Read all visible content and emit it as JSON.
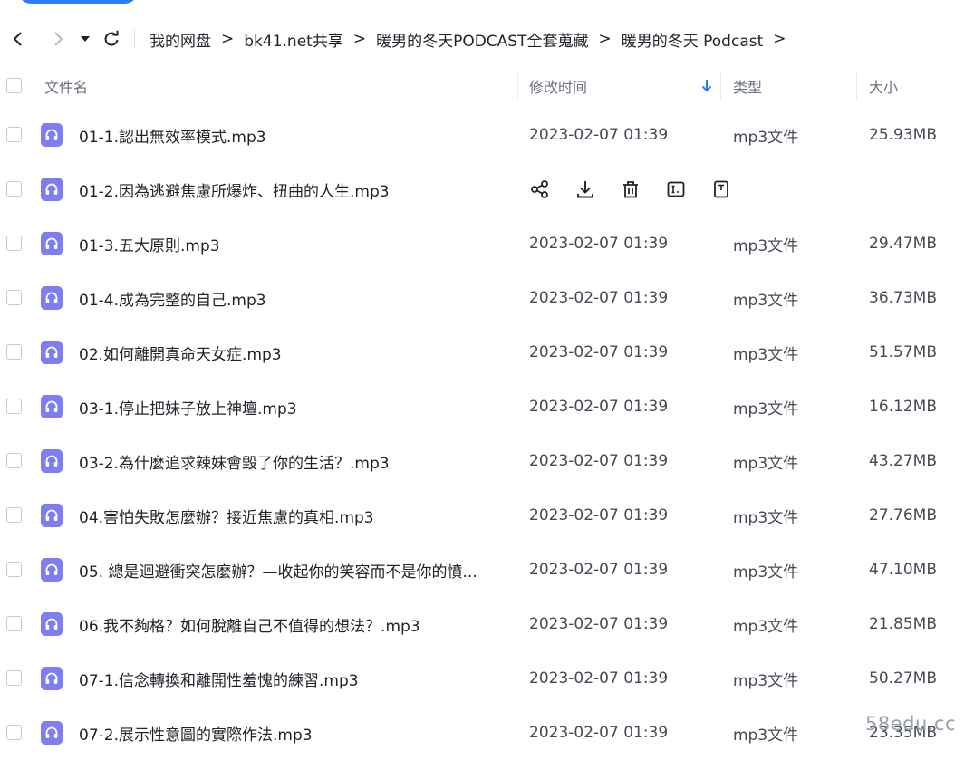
{
  "breadcrumb": [
    "我的网盘",
    "bk41.net共享",
    "暖男的冬天PODCAST全套蒐藏",
    "暖男的冬天 Podcast"
  ],
  "breadcrumb_separator": ">",
  "columns": {
    "name": "文件名",
    "modified": "修改时间",
    "type": "类型",
    "size": "大小"
  },
  "files": [
    {
      "name": "01-1.認出無效率模式.mp3",
      "modified": "2023-02-07 01:39",
      "type": "mp3文件",
      "size": "25.93MB"
    },
    {
      "name": "01-2.因為逃避焦慮所爆炸、扭曲的人生.mp3",
      "modified": "",
      "type": "",
      "size": "",
      "hovered": true
    },
    {
      "name": "01-3.五大原則.mp3",
      "modified": "2023-02-07 01:39",
      "type": "mp3文件",
      "size": "29.47MB"
    },
    {
      "name": "01-4.成為完整的自己.mp3",
      "modified": "2023-02-07 01:39",
      "type": "mp3文件",
      "size": "36.73MB"
    },
    {
      "name": "02.如何離開真命天女症.mp3",
      "modified": "2023-02-07 01:39",
      "type": "mp3文件",
      "size": "51.57MB"
    },
    {
      "name": "03-1.停止把妹子放上神壇.mp3",
      "modified": "2023-02-07 01:39",
      "type": "mp3文件",
      "size": "16.12MB"
    },
    {
      "name": "03-2.為什麼追求辣妹會毀了你的生活？.mp3",
      "modified": "2023-02-07 01:39",
      "type": "mp3文件",
      "size": "43.27MB"
    },
    {
      "name": "04.害怕失敗怎麼辦？接近焦慮的真相.mp3",
      "modified": "2023-02-07 01:39",
      "type": "mp3文件",
      "size": "27.76MB"
    },
    {
      "name": "05. 總是迴避衝突怎麼辦？—收起你的笑容而不是你的憤...",
      "modified": "2023-02-07 01:39",
      "type": "mp3文件",
      "size": "47.10MB"
    },
    {
      "name": "06.我不夠格？如何脫離自己不值得的想法？.mp3",
      "modified": "2023-02-07 01:39",
      "type": "mp3文件",
      "size": "21.85MB"
    },
    {
      "name": "07-1.信念轉換和離開性羞愧的練習.mp3",
      "modified": "2023-02-07 01:39",
      "type": "mp3文件",
      "size": "50.27MB"
    },
    {
      "name": "07-2.展示性意圖的實際作法.mp3",
      "modified": "2023-02-07 01:39",
      "type": "mp3文件",
      "size": "23.35MB"
    }
  ],
  "row_actions": [
    "share-icon",
    "download-icon",
    "delete-icon",
    "rename-icon",
    "more-icon"
  ],
  "watermark": "58edu.cc",
  "colors": {
    "accent": "#2f7cf6",
    "file_icon": "#7f7df2",
    "text": "#1f2329",
    "muted": "#6b7180"
  }
}
